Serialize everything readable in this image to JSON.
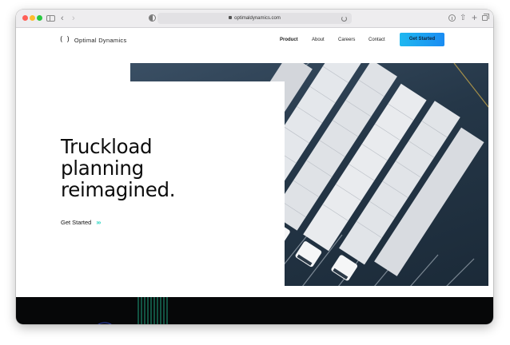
{
  "browser": {
    "url": "optimaldynamics.com"
  },
  "nav": {
    "logo_text": "Optimal Dynamics",
    "links": [
      {
        "label": "Product",
        "active": true
      },
      {
        "label": "About",
        "active": false
      },
      {
        "label": "Careers",
        "active": false
      },
      {
        "label": "Contact",
        "active": false
      }
    ],
    "cta_label": "Get Started"
  },
  "hero": {
    "headline_lines": [
      "Truckload",
      "planning",
      "reimagined."
    ],
    "link_label": "Get Started",
    "link_arrows": "›››"
  },
  "colors": {
    "cta_gradient_start": "#1fb8f0",
    "cta_gradient_end": "#1a8cf2",
    "arrow_accent": "#2bd6c3",
    "dark_band": "#060708"
  }
}
